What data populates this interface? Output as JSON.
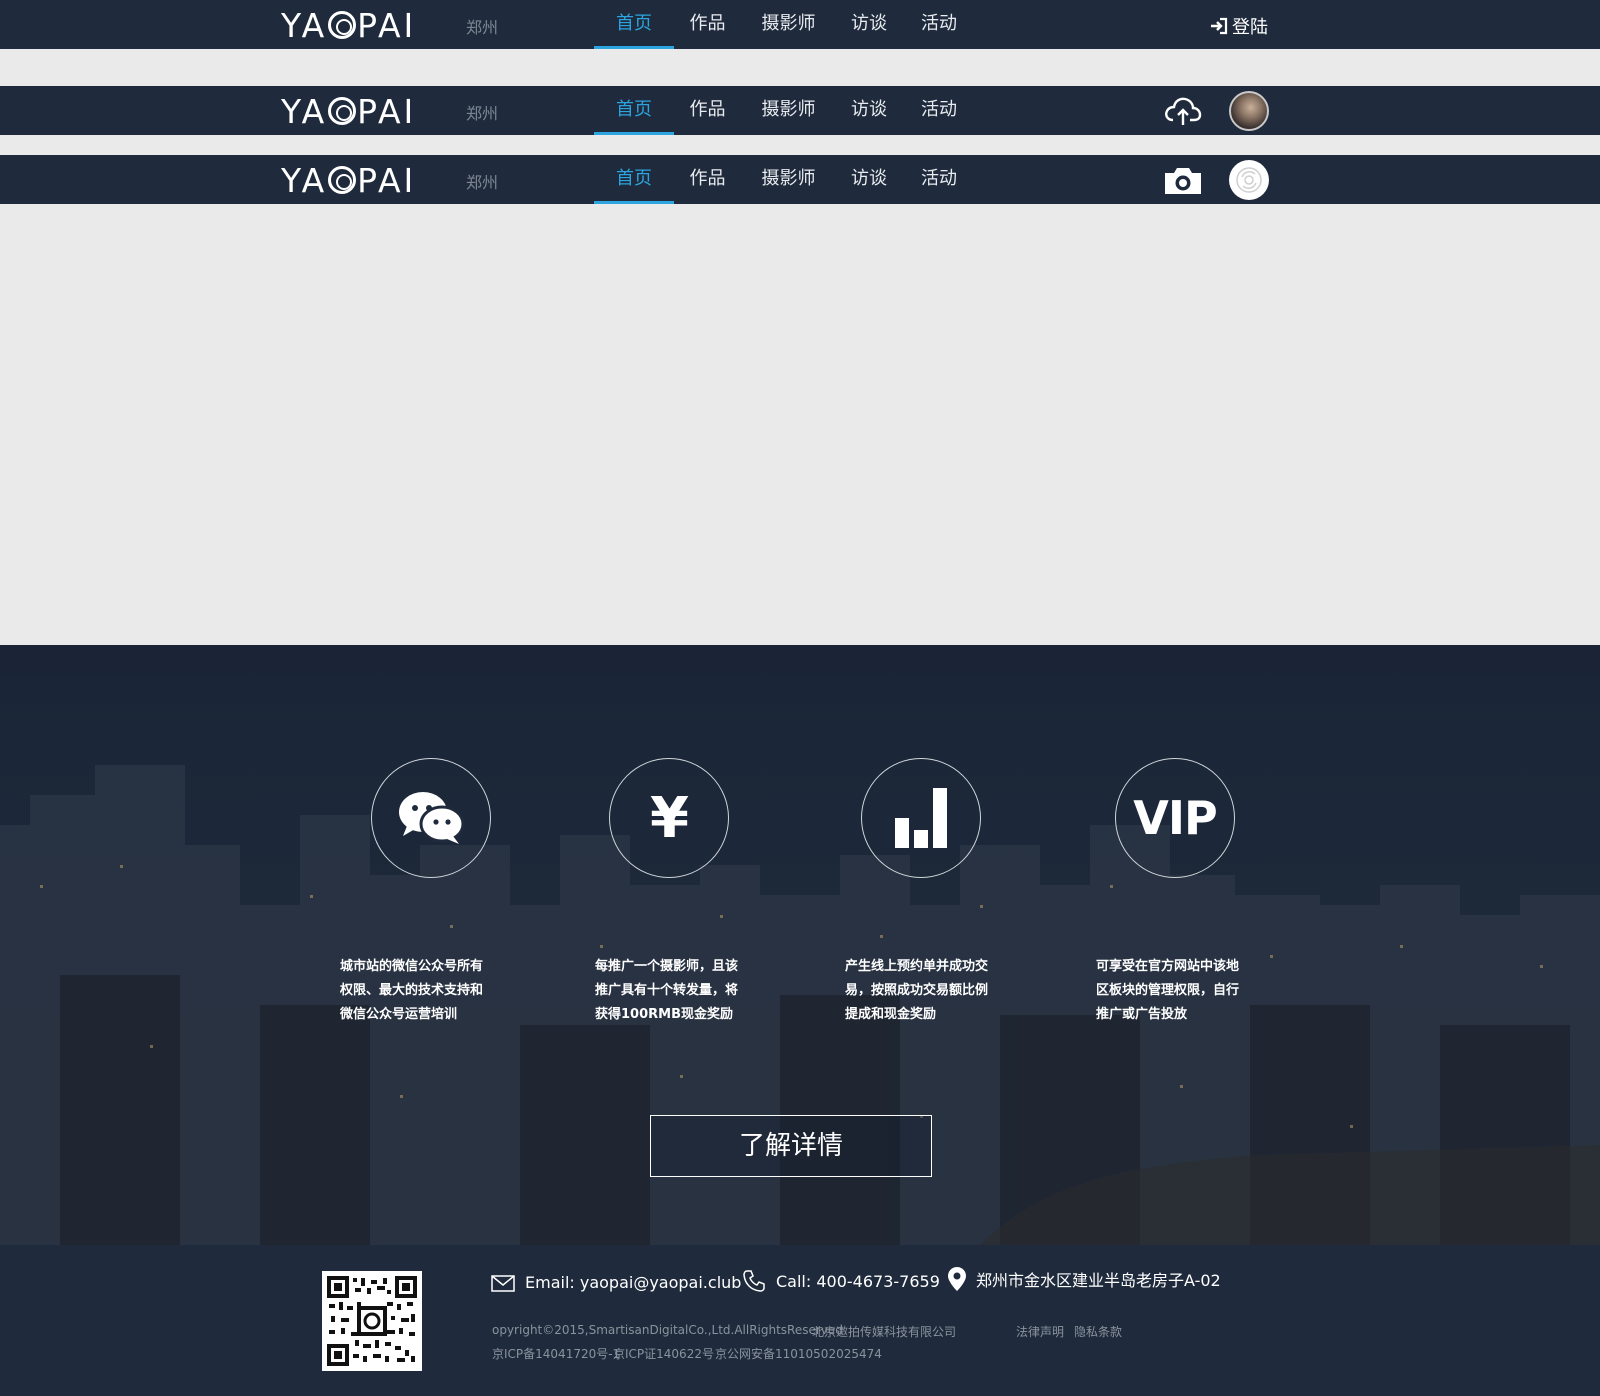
{
  "header": {
    "logo_text": "YAOPAI",
    "city": "郑州",
    "nav": [
      "首页",
      "作品",
      "摄影师",
      "访谈",
      "活动"
    ],
    "login": "登陆",
    "accent": "#2ba4e0",
    "bg": "#1f2b3c"
  },
  "promo": {
    "features": [
      {
        "icon": "wechat-icon",
        "text_lines": [
          "城市站的微信公众号所有",
          "权限、最大的技术支持和",
          "微信公众号运营培训"
        ]
      },
      {
        "icon": "yuan-icon",
        "symbol": "¥",
        "text_lines": [
          "每推广一个摄影师，且该",
          "推广具有十个转发量，将",
          "获得100RMB现金奖励"
        ]
      },
      {
        "icon": "bar-chart-icon",
        "text_lines": [
          "产生线上预约单并成功交",
          "易，按照成功交易额比例",
          "提成和现金奖励"
        ]
      },
      {
        "icon": "vip-icon",
        "symbol": "VIP",
        "text_lines": [
          "可享受在官方网站中该地",
          "区板块的管理权限，自行",
          "推广或广告投放"
        ]
      }
    ],
    "detail_button": "了解详情"
  },
  "footer": {
    "email": "Email: yaopai@yaopai.club",
    "phone": "Call: 400-4673-7659",
    "address": "郑州市金水区建业半岛老房子A-02",
    "copyright": "opyright©2015,SmartisanDigitalCo.,Ltd.AllRightsReserved",
    "company": "北京邀拍传媒科技有限公司",
    "legal_statement": "法律声明",
    "privacy": "隐私条款",
    "icp1": "京ICP备14041720号-1",
    "icp2": "京ICP证140622号",
    "police": "京公网安备11010502025474"
  }
}
